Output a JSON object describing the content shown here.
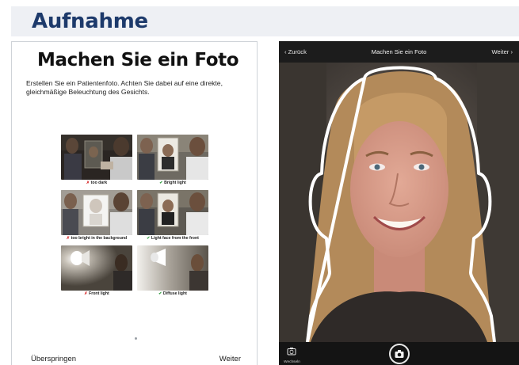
{
  "banner": {
    "title": "Aufnahme"
  },
  "intro": {
    "heading": "Machen Sie ein Foto",
    "description": "Erstellen Sie ein Patientenfoto. Achten Sie dabei auf eine direkte, gleichmäßige Beleuchtung des Gesichts."
  },
  "tips": [
    {
      "mark": "✗",
      "label": "too dark",
      "good": false
    },
    {
      "mark": "✔",
      "label": "Bright light",
      "good": true
    },
    {
      "mark": "✗",
      "label": "too bright in the background",
      "good": false
    },
    {
      "mark": "✔",
      "label": "Light face from the front",
      "good": true
    },
    {
      "mark": "✗",
      "label": "Front light",
      "good": false
    },
    {
      "mark": "✔",
      "label": "Diffuse light",
      "good": true
    }
  ],
  "footer": {
    "skip_label": "Überspringen",
    "next_label": "Weiter"
  },
  "camera": {
    "back_label": "Zurück",
    "title": "Machen Sie ein Foto",
    "next_label": "Weiter",
    "switch_label": "Wechseln"
  },
  "colors": {
    "brand_title": "#1d3a6b",
    "bad_mark": "#d62020",
    "good_mark": "#2b9a3b"
  },
  "icons": [
    "chevron-left-icon",
    "chevron-right-icon",
    "camera-switch-icon",
    "camera-icon",
    "lamp-icon"
  ]
}
